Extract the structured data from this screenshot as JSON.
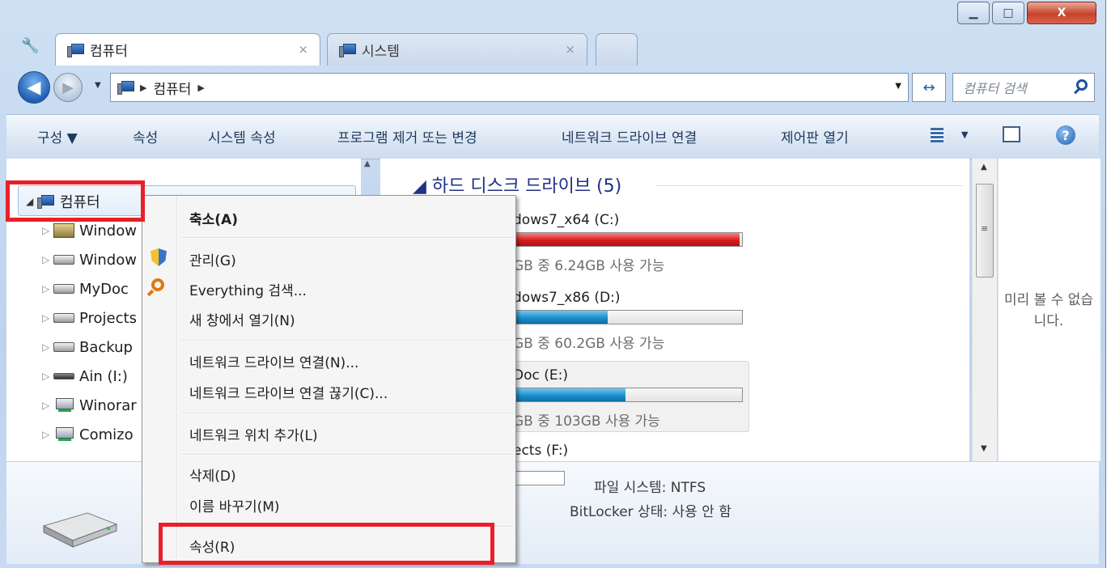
{
  "window": {
    "min_symbol": "▁",
    "max_symbol": "□",
    "close_symbol": "X"
  },
  "tabs": [
    {
      "label": "컴퓨터",
      "close": "×"
    },
    {
      "label": "시스템",
      "close": "×"
    }
  ],
  "address": {
    "crumb": "컴퓨터",
    "arrow": "▶",
    "dropdown": "▼",
    "refresh": "↔",
    "search_placeholder": "컴퓨터 검색"
  },
  "nav": {
    "back": "◀",
    "forward": "▶",
    "history_dropdown": "▼"
  },
  "command_bar": {
    "organize": "구성 ▼",
    "properties": "속성",
    "system_properties": "시스템 속성",
    "uninstall": "프로그램 제거 또는 변경",
    "map_drive": "네트워크 드라이브 연결",
    "control_panel": "제어판 열기",
    "view_dropdown": "▼",
    "help": "?"
  },
  "tree": {
    "root": "컴퓨터",
    "expanded_glyph": "◢",
    "collapsed_glyph": "▷",
    "items": [
      {
        "label": "Window",
        "icon": "system-drive-icon"
      },
      {
        "label": "Window",
        "icon": "drive-icon"
      },
      {
        "label": "MyDoc",
        "icon": "drive-icon"
      },
      {
        "label": "Projects",
        "icon": "drive-icon"
      },
      {
        "label": "Backup",
        "icon": "drive-icon"
      },
      {
        "label": "Ain (I:)",
        "icon": "removable-drive-icon"
      },
      {
        "label": "Winorar",
        "icon": "network-drive-icon"
      },
      {
        "label": "Comizo",
        "icon": "network-drive-icon"
      }
    ]
  },
  "content": {
    "group_heading": "◢ 하드 디스크 드라이브 (5)",
    "drives": [
      {
        "name": "dows7_x64 (C:)",
        "free": "GB 중 6.24GB 사용 가능",
        "used_fraction": 0.99,
        "color": "#d61e1e"
      },
      {
        "name": "dows7_x86 (D:)",
        "free": "GB 중 60.2GB 사용 가능",
        "used_fraction": 0.41,
        "color": "#1e8fcd"
      },
      {
        "name": "Doc (E:)",
        "free": "GB 중 103GB 사용 가능",
        "used_fraction": 0.49,
        "color": "#1e8fcd"
      },
      {
        "name": "ects (F:)"
      }
    ]
  },
  "preview": {
    "text": "미리 볼 수 없습니다."
  },
  "details": {
    "filesystem": "파일 시스템: NTFS",
    "bitlocker": "BitLocker 상태: 사용 안 함"
  },
  "context_menu": {
    "items": [
      {
        "label": "축소(A)",
        "bold": true
      },
      {
        "label": "관리(G)"
      },
      {
        "label": "Everything 검색..."
      },
      {
        "label": "새 창에서 열기(N)"
      },
      {
        "label": "네트워크 드라이브 연결(N)..."
      },
      {
        "label": "네트워크 드라이브 연결 끊기(C)..."
      },
      {
        "label": "네트워크 위치 추가(L)"
      },
      {
        "label": "삭제(D)"
      },
      {
        "label": "이름 바꾸기(M)"
      },
      {
        "label": "속성(R)"
      }
    ]
  },
  "colors": {
    "highlight": "#e8202a",
    "heading": "#1e3287"
  }
}
